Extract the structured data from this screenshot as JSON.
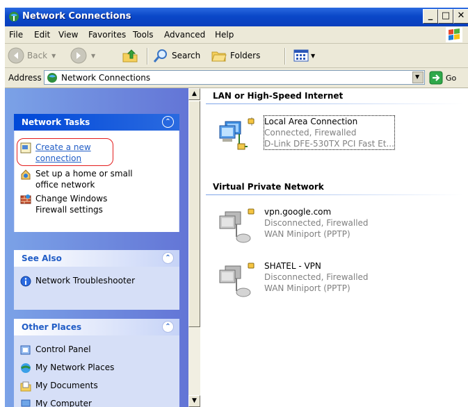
{
  "window": {
    "title": "Network Connections",
    "controls": {
      "minimize": "_",
      "maximize": "□",
      "close": "✕"
    }
  },
  "menu": [
    "File",
    "Edit",
    "View",
    "Favorites",
    "Tools",
    "Advanced",
    "Help"
  ],
  "toolbar": {
    "back": "Back",
    "search": "Search",
    "folders": "Folders"
  },
  "address": {
    "label": "Address",
    "value": "Network Connections",
    "go": "Go"
  },
  "left_pane": {
    "network_tasks": {
      "title": "Network Tasks",
      "items": [
        {
          "label_line1": "Create a new",
          "label_line2": "connection",
          "icon": "new-connection-icon"
        },
        {
          "label_line1": "Set up a home or small",
          "label_line2": "office network",
          "icon": "home-network-icon"
        },
        {
          "label_line1": "Change Windows",
          "label_line2": "Firewall settings",
          "icon": "firewall-icon"
        }
      ]
    },
    "see_also": {
      "title": "See Also",
      "items": [
        {
          "label": "Network Troubleshooter",
          "icon": "info-icon"
        }
      ]
    },
    "other_places": {
      "title": "Other Places",
      "items": [
        {
          "label": "Control Panel",
          "icon": "control-panel-icon"
        },
        {
          "label": "My Network Places",
          "icon": "network-places-icon"
        },
        {
          "label": "My Documents",
          "icon": "documents-icon"
        },
        {
          "label": "My Computer",
          "icon": "computer-icon"
        }
      ]
    }
  },
  "right_pane": {
    "groups": [
      {
        "title": "LAN or High-Speed Internet",
        "connections": [
          {
            "name": "Local Area Connection",
            "status": "Connected, Firewalled",
            "device": "D-Link DFE-530TX PCI Fast Et..."
          }
        ]
      },
      {
        "title": "Virtual Private Network",
        "connections": [
          {
            "name": "vpn.google.com",
            "status": "Disconnected, Firewalled",
            "device": "WAN Miniport (PPTP)"
          },
          {
            "name": "SHATEL - VPN",
            "status": "Disconnected, Firewalled",
            "device": "WAN Miniport (PPTP)"
          }
        ]
      }
    ]
  },
  "colors": {
    "titlebar": "#0a47c8",
    "task_link": "#215dc6",
    "highlight_ring": "#e31c1c",
    "left_pane": "#6f8edb"
  }
}
